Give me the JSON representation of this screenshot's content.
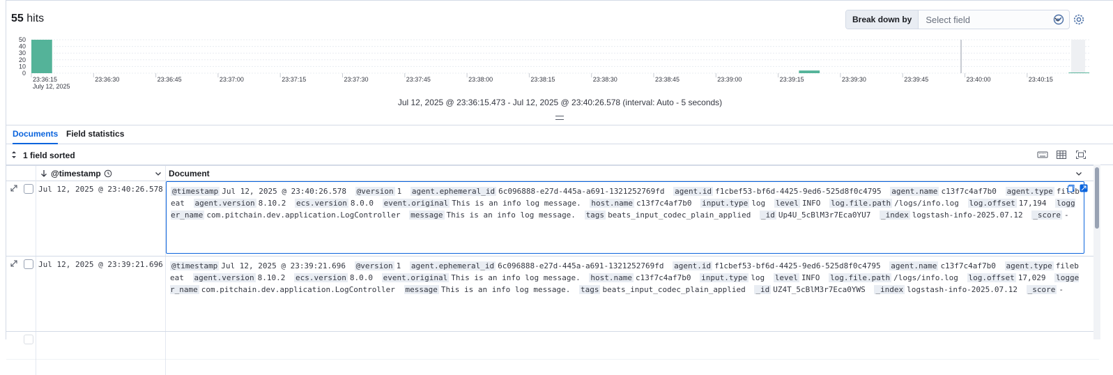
{
  "header": {
    "hits_count": "55",
    "hits_label": "hits",
    "breakdown_label": "Break down by",
    "breakdown_placeholder": "Select field",
    "icons": [
      "chart-options-icon",
      "gear-icon"
    ]
  },
  "chart_data": {
    "type": "bar",
    "title": "",
    "xlabel": "",
    "ylabel": "",
    "ylim": [
      0,
      50
    ],
    "y_ticks": [
      "50",
      "40",
      "30",
      "20",
      "10",
      "0"
    ],
    "x_ticks": [
      "23:36:15",
      "23:36:30",
      "23:36:45",
      "23:37:00",
      "23:37:15",
      "23:37:30",
      "23:37:45",
      "23:38:00",
      "23:38:15",
      "23:38:30",
      "23:38:45",
      "23:39:00",
      "23:39:15",
      "23:39:30",
      "23:39:45",
      "23:40:00",
      "23:40:15"
    ],
    "x_subtitle": "July 12, 2025",
    "bars": [
      {
        "x": "23:36:15",
        "value": 50
      },
      {
        "x": "23:39:20",
        "value": 4
      },
      {
        "x": "23:40:25",
        "value": 1
      }
    ],
    "interval_seconds": 5,
    "bar_color": "#54b399",
    "grid": true
  },
  "time_caption": "Jul 12, 2025 @ 23:36:15.473 - Jul 12, 2025 @ 23:40:26.578 (interval: Auto - 5 seconds)",
  "tabs": [
    {
      "label": "Documents",
      "active": true
    },
    {
      "label": "Field statistics",
      "active": false
    }
  ],
  "toolbar": {
    "sorted_label": "1 field sorted",
    "icons": [
      "keyboard-icon",
      "table-density-icon",
      "fullscreen-icon"
    ]
  },
  "columns": {
    "timestamp": "@timestamp",
    "document": "Document"
  },
  "rows": [
    {
      "timestamp": "Jul 12, 2025 @ 23:40:26.578",
      "fields": [
        [
          "@timestamp",
          "Jul 12, 2025 @ 23:40:26.578"
        ],
        [
          "@version",
          "1"
        ],
        [
          "agent.ephemeral_id",
          "6c096888-e27d-445a-a691-1321252769fd"
        ],
        [
          "agent.id",
          "f1cbef53-bf6d-4425-9ed6-525d8f0c4795"
        ],
        [
          "agent.name",
          "c13f7c4af7b0"
        ],
        [
          "agent.type",
          "filebeat"
        ],
        [
          "agent.version",
          "8.10.2"
        ],
        [
          "ecs.version",
          "8.0.0"
        ],
        [
          "event.original",
          "This is an info log message."
        ],
        [
          "host.name",
          "c13f7c4af7b0"
        ],
        [
          "input.type",
          "log"
        ],
        [
          "level",
          "INFO"
        ],
        [
          "log.file.path",
          "/logs/info.log"
        ],
        [
          "log.offset",
          "17,194"
        ],
        [
          "logger_name",
          "com.pitchain.dev.application.LogController"
        ],
        [
          "message",
          "This is an info log message."
        ],
        [
          "tags",
          "beats_input_codec_plain_applied"
        ],
        [
          "_id",
          "Up4U_5cBlM3r7Eca0YU7"
        ],
        [
          "_index",
          "logstash-info-2025.07.12"
        ],
        [
          "_score",
          "-"
        ]
      ]
    },
    {
      "timestamp": "Jul 12, 2025 @ 23:39:21.696",
      "fields": [
        [
          "@timestamp",
          "Jul 12, 2025 @ 23:39:21.696"
        ],
        [
          "@version",
          "1"
        ],
        [
          "agent.ephemeral_id",
          "6c096888-e27d-445a-a691-1321252769fd"
        ],
        [
          "agent.id",
          "f1cbef53-bf6d-4425-9ed6-525d8f0c4795"
        ],
        [
          "agent.name",
          "c13f7c4af7b0"
        ],
        [
          "agent.type",
          "filebeat"
        ],
        [
          "agent.version",
          "8.10.2"
        ],
        [
          "ecs.version",
          "8.0.0"
        ],
        [
          "event.original",
          "This is an info log message."
        ],
        [
          "host.name",
          "c13f7c4af7b0"
        ],
        [
          "input.type",
          "log"
        ],
        [
          "level",
          "INFO"
        ],
        [
          "log.file.path",
          "/logs/info.log"
        ],
        [
          "log.offset",
          "17,029"
        ],
        [
          "logger_name",
          "com.pitchain.dev.application.LogController"
        ],
        [
          "message",
          "This is an info log message."
        ],
        [
          "tags",
          "beats_input_codec_plain_applied"
        ],
        [
          "_id",
          "UZ4T_5cBlM3r7Eca0YWS"
        ],
        [
          "_index",
          "logstash-info-2025.07.12"
        ],
        [
          "_score",
          "-"
        ]
      ]
    }
  ]
}
